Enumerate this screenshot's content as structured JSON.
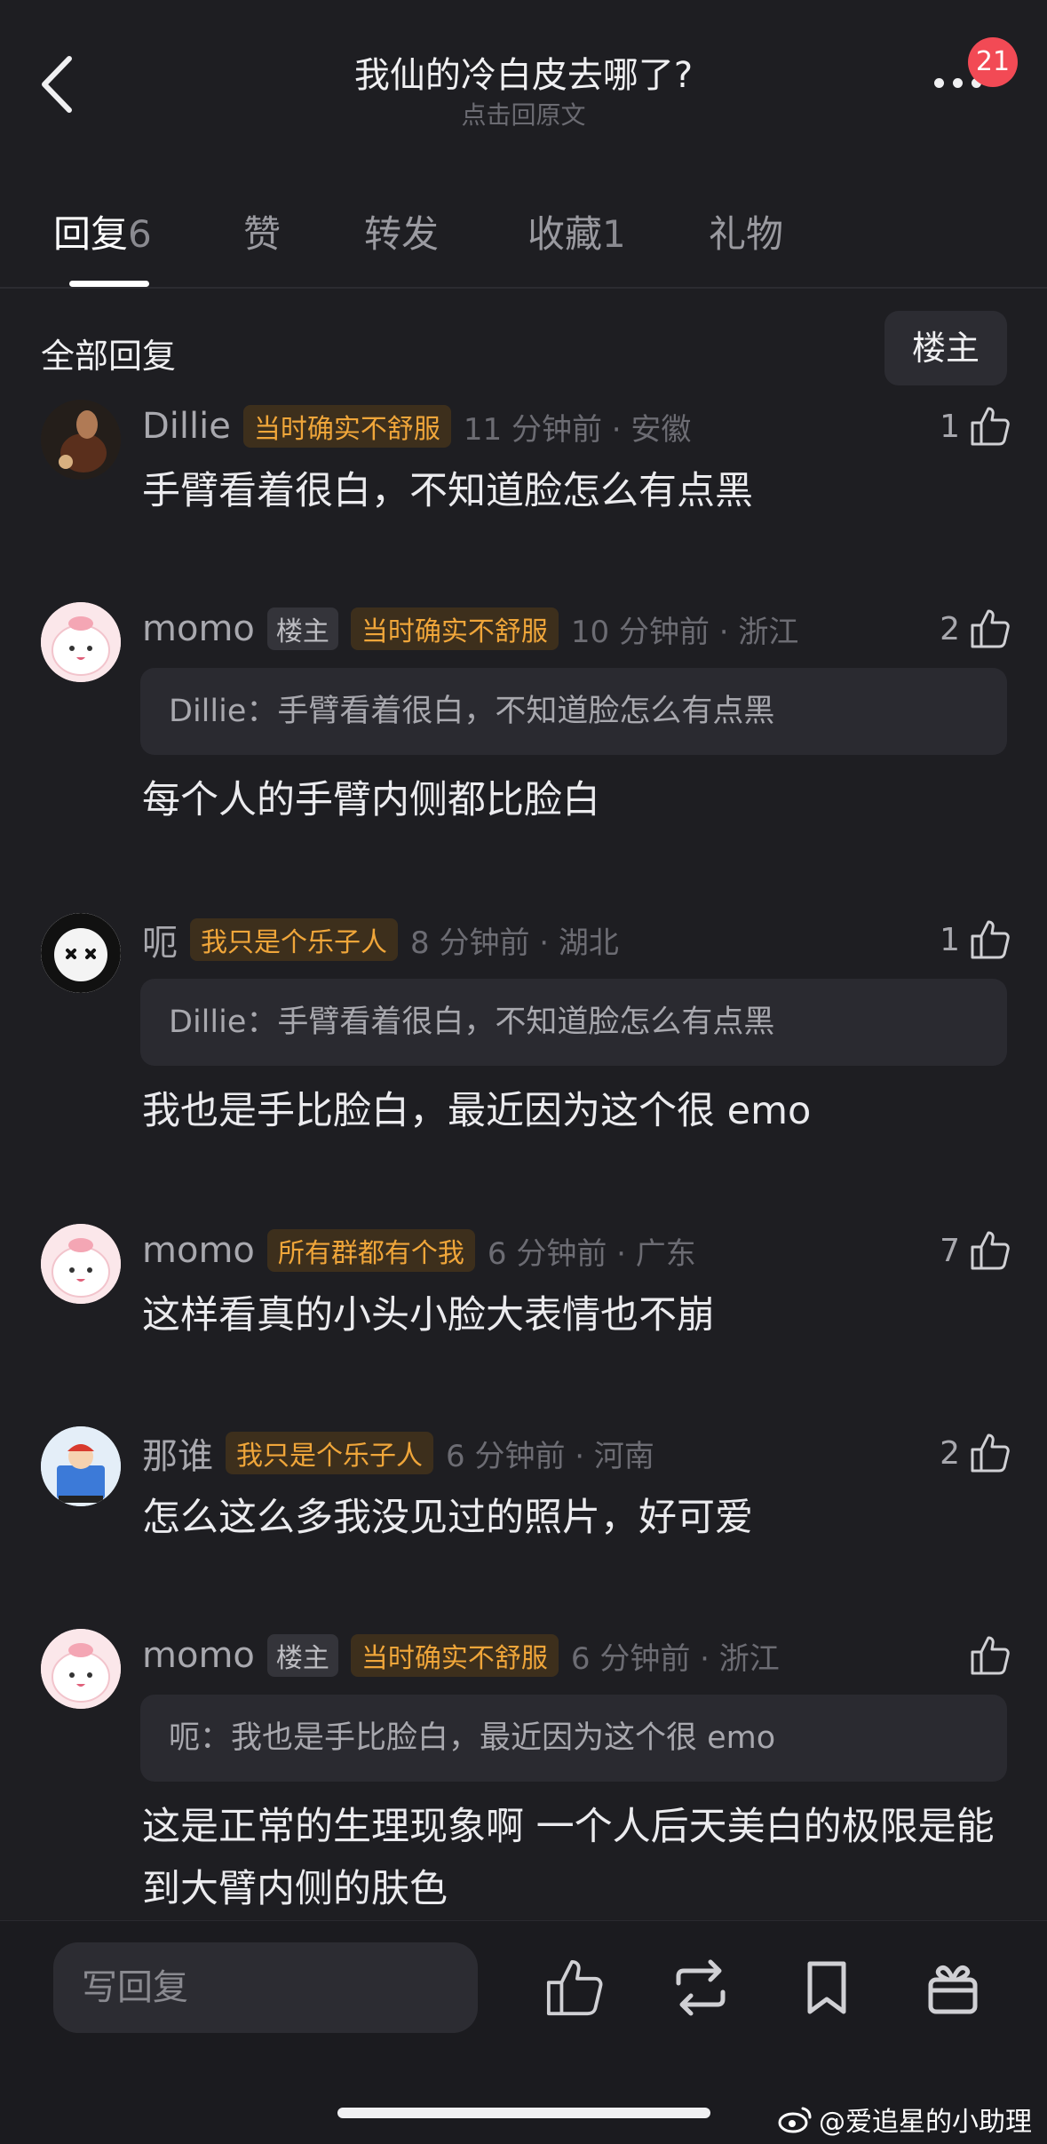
{
  "header": {
    "title": "我仙的冷白皮去哪了?",
    "subtitle": "点击回原文",
    "badge_count": "21"
  },
  "tabs": [
    {
      "label": "回复",
      "count": "6",
      "active": true
    },
    {
      "label": "赞",
      "count": ""
    },
    {
      "label": "转发",
      "count": ""
    },
    {
      "label": "收藏",
      "count": "1"
    },
    {
      "label": "礼物",
      "count": ""
    }
  ],
  "section": {
    "title": "全部回复",
    "filter_label": "楼主"
  },
  "comments": [
    {
      "user": "Dillie",
      "op_tag": "",
      "fan_tag": "当时确实不舒服",
      "time_loc": "11 分钟前 · 安徽",
      "likes": "1",
      "quote": "",
      "text": "手臂看着很白，不知道脸怎么有点黑"
    },
    {
      "user": "momo",
      "op_tag": "楼主",
      "fan_tag": "当时确实不舒服",
      "time_loc": "10 分钟前 · 浙江",
      "likes": "2",
      "quote": "Dillie：手臂看着很白，不知道脸怎么有点黑",
      "text": "每个人的手臂内侧都比脸白"
    },
    {
      "user": "呃",
      "op_tag": "",
      "fan_tag": "我只是个乐子人",
      "time_loc": "8 分钟前 · 湖北",
      "likes": "1",
      "quote": "Dillie：手臂看着很白，不知道脸怎么有点黑",
      "text": "我也是手比脸白，最近因为这个很 emo"
    },
    {
      "user": "momo",
      "op_tag": "",
      "fan_tag": "所有群都有个我",
      "time_loc": "6 分钟前 · 广东",
      "likes": "7",
      "quote": "",
      "text": "这样看真的小头小脸大表情也不崩"
    },
    {
      "user": "那谁",
      "op_tag": "",
      "fan_tag": "我只是个乐子人",
      "time_loc": "6 分钟前 · 河南",
      "likes": "2",
      "quote": "",
      "text": "怎么这么多我没见过的照片，好可爱"
    },
    {
      "user": "momo",
      "op_tag": "楼主",
      "fan_tag": "当时确实不舒服",
      "time_loc": "6 分钟前 · 浙江",
      "likes": "",
      "quote": "呃：我也是手比脸白，最近因为这个很 emo",
      "text": "这是正常的生理现象啊 一个人后天美白的极限是能到大臂内侧的肤色"
    }
  ],
  "bottom": {
    "reply_placeholder": "写回复"
  },
  "watermark": "@爱追星的小助理",
  "colors": {
    "background": "#1e1e22",
    "fan_tag_text": "#f0a63a",
    "badge": "#f24a55"
  }
}
